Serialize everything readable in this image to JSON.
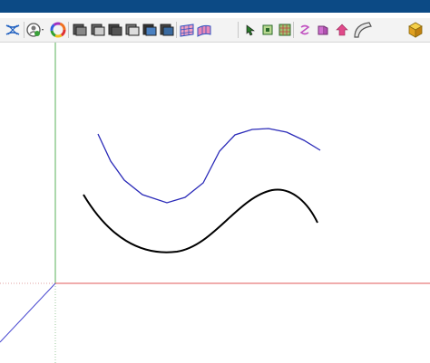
{
  "window": {
    "title_bar_color": "#0c4a85"
  },
  "toolbar": {
    "background": "#f3f3f3",
    "buttons": [
      "blend-curves-icon",
      "user-settings-icon",
      "color-wheel-icon",
      "view-cube-1-icon",
      "view-cube-2-icon",
      "view-cube-3-icon",
      "view-cube-4-icon",
      "view-cube-5-icon",
      "view-cube-6-icon",
      "surface-mesh-icon",
      "surface-uv-icon",
      "select-point-icon",
      "green-box-icon",
      "box-grid-icon",
      "sweep-icon",
      "extrude-icon",
      "home-arrow-icon",
      "curved-shell-icon",
      "solid-cube-icon"
    ]
  },
  "viewport": {
    "axis_colors": {
      "x": "#e05a5a",
      "y": "#58b058",
      "z": "#4a4ad0"
    },
    "curves": [
      {
        "name": "control-polyline",
        "color": "#2a2ab8"
      },
      {
        "name": "spline-curve",
        "color": "#000000"
      }
    ]
  }
}
